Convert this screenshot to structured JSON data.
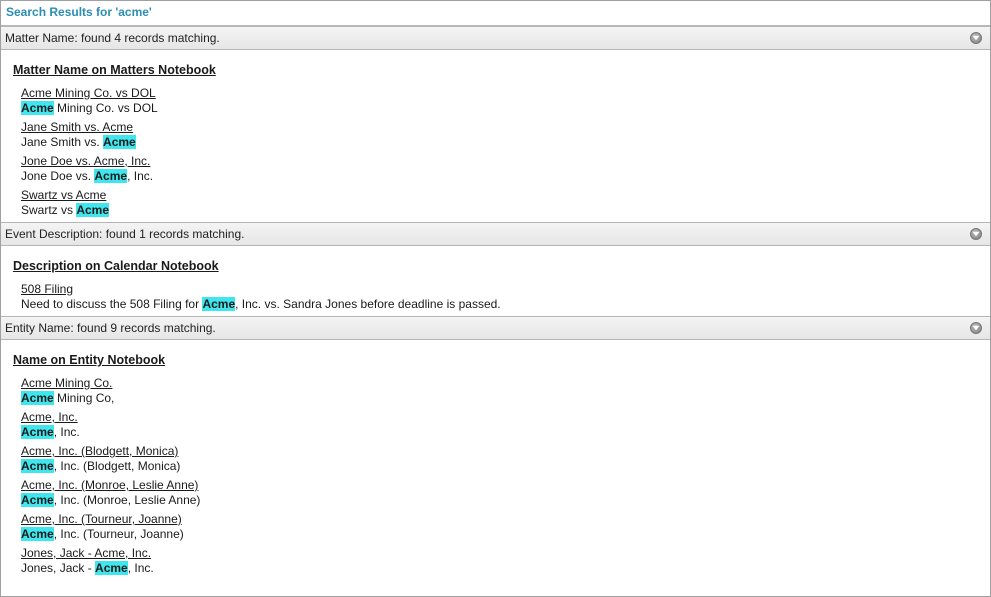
{
  "title": "Search Results for 'acme'",
  "sections": [
    {
      "header": "Matter Name: found 4 records matching.",
      "subhead": "Matter Name on Matters Notebook",
      "records": [
        {
          "link": "Acme Mining Co. vs DOL",
          "parts": [
            {
              "t": "Acme",
              "h": true
            },
            {
              "t": " Mining Co. vs DOL"
            }
          ]
        },
        {
          "link": "Jane Smith vs. Acme",
          "parts": [
            {
              "t": "Jane Smith vs. "
            },
            {
              "t": "Acme",
              "h": true
            }
          ]
        },
        {
          "link": "Jone Doe vs. Acme, Inc.",
          "parts": [
            {
              "t": "Jone Doe vs. "
            },
            {
              "t": "Acme",
              "h": true
            },
            {
              "t": ", Inc."
            }
          ]
        },
        {
          "link": "Swartz vs Acme",
          "parts": [
            {
              "t": "Swartz vs "
            },
            {
              "t": "Acme",
              "h": true
            }
          ]
        }
      ]
    },
    {
      "header": "Event Description: found 1 records matching.",
      "subhead": "Description on Calendar Notebook",
      "records": [
        {
          "link": "508 Filing",
          "parts": [
            {
              "t": "Need to discuss the 508 Filing for "
            },
            {
              "t": "Acme",
              "h": true
            },
            {
              "t": ", Inc. vs. Sandra Jones before deadline is passed."
            }
          ]
        }
      ]
    },
    {
      "header": "Entity Name: found 9 records matching.",
      "subhead": "Name on Entity Notebook",
      "records": [
        {
          "link": "Acme Mining Co.",
          "parts": [
            {
              "t": "Acme",
              "h": true
            },
            {
              "t": " Mining Co,"
            }
          ]
        },
        {
          "link": "Acme, Inc.",
          "parts": [
            {
              "t": "Acme",
              "h": true
            },
            {
              "t": ", Inc."
            }
          ]
        },
        {
          "link": "Acme, Inc. (Blodgett, Monica)",
          "parts": [
            {
              "t": "Acme",
              "h": true
            },
            {
              "t": ", Inc. (Blodgett, Monica)"
            }
          ]
        },
        {
          "link": "Acme, Inc. (Monroe, Leslie Anne)",
          "parts": [
            {
              "t": "Acme",
              "h": true
            },
            {
              "t": ", Inc. (Monroe, Leslie Anne)"
            }
          ]
        },
        {
          "link": "Acme, Inc. (Tourneur, Joanne)",
          "parts": [
            {
              "t": "Acme",
              "h": true
            },
            {
              "t": ", Inc. (Tourneur, Joanne)"
            }
          ]
        },
        {
          "link": "Jones, Jack - Acme, Inc.",
          "parts": [
            {
              "t": "Jones, Jack - "
            },
            {
              "t": "Acme",
              "h": true
            },
            {
              "t": ", Inc."
            }
          ]
        }
      ]
    }
  ],
  "highlight_color": "#3fe6ee",
  "title_color": "#2a8db3",
  "icons": {
    "section_toggle": "chevron-down-circle-icon"
  }
}
